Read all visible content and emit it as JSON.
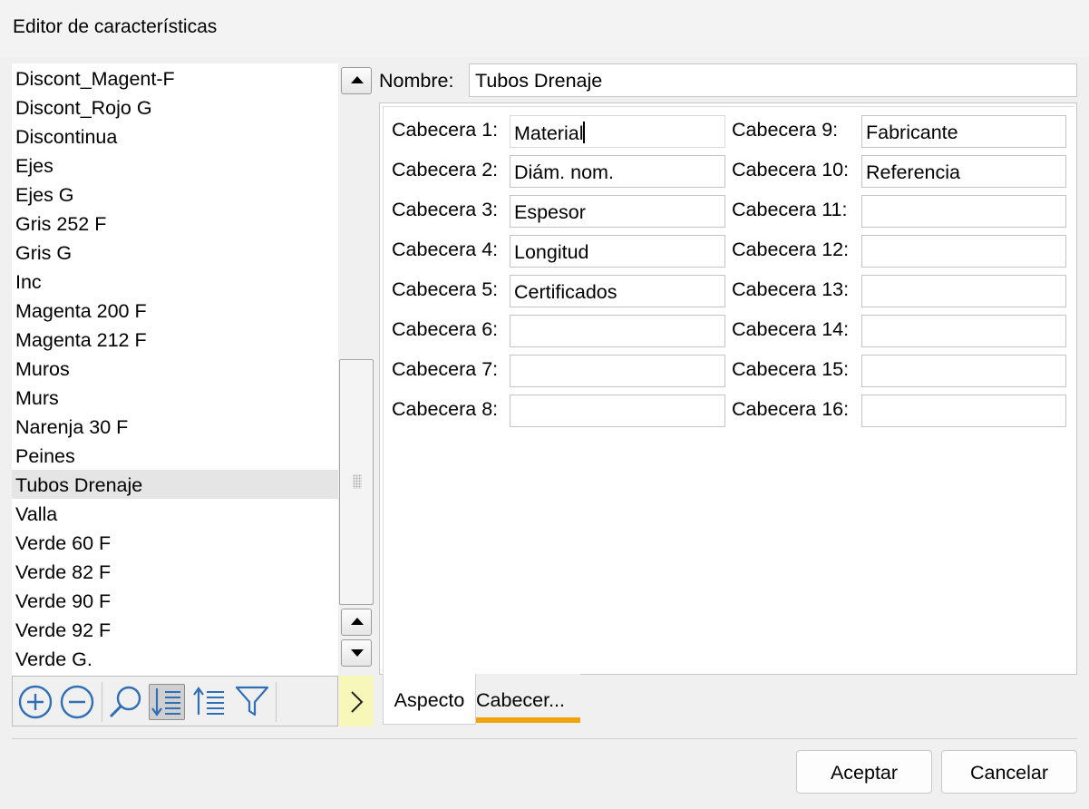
{
  "window": {
    "title": "Editor de características"
  },
  "list": {
    "items": [
      "Discont_Magent-F",
      "Discont_Rojo G",
      "Discontinua",
      "Ejes",
      "Ejes G",
      "Gris 252 F",
      "Gris G",
      "Inc",
      "Magenta 200 F",
      "Magenta 212 F",
      "Muros",
      "Murs",
      "Narenja 30 F",
      "Peines",
      "Tubos Drenaje",
      "Valla",
      "Verde 60 F",
      "Verde 82 F",
      "Verde 90 F",
      "Verde 92 F",
      "Verde G."
    ],
    "selected": "Tubos Drenaje"
  },
  "toolbar": {
    "icons": [
      "add-icon",
      "remove-icon",
      "search-icon",
      "sort-descending-icon",
      "sort-ascending-icon",
      "filter-icon"
    ],
    "active": "sort-descending-icon"
  },
  "name": {
    "label": "Nombre:",
    "value": "Tubos Drenaje"
  },
  "headers": {
    "left": [
      {
        "label": "Cabecera 1:",
        "value": "Material"
      },
      {
        "label": "Cabecera 2:",
        "value": "Diám. nom."
      },
      {
        "label": "Cabecera 3:",
        "value": "Espesor"
      },
      {
        "label": "Cabecera 4:",
        "value": "Longitud"
      },
      {
        "label": "Cabecera 5:",
        "value": "Certificados"
      },
      {
        "label": "Cabecera 6:",
        "value": ""
      },
      {
        "label": "Cabecera 7:",
        "value": ""
      },
      {
        "label": "Cabecera 8:",
        "value": ""
      }
    ],
    "right": [
      {
        "label": "Cabecera 9:",
        "value": "Fabricante"
      },
      {
        "label": "Cabecera 10:",
        "value": "Referencia"
      },
      {
        "label": "Cabecera 11:",
        "value": ""
      },
      {
        "label": "Cabecera 12:",
        "value": ""
      },
      {
        "label": "Cabecera 13:",
        "value": ""
      },
      {
        "label": "Cabecera 14:",
        "value": ""
      },
      {
        "label": "Cabecera 15:",
        "value": ""
      },
      {
        "label": "Cabecera 16:",
        "value": ""
      }
    ]
  },
  "tabs": {
    "aspecto": "Aspecto",
    "cabecera": "Cabecer...",
    "active": "cabecera",
    "accent": "#f0a30a"
  },
  "buttons": {
    "ok": "Aceptar",
    "cancel": "Cancelar"
  }
}
